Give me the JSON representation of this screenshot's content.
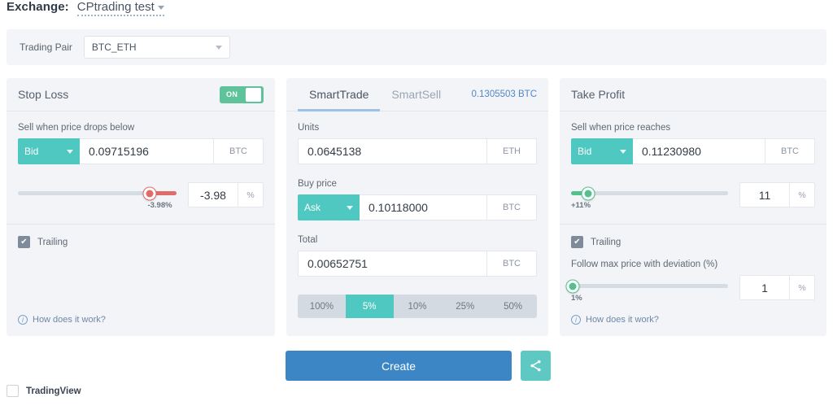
{
  "header": {
    "exchange_label": "Exchange:",
    "exchange_value": "CPtrading test"
  },
  "trading_pair": {
    "label": "Trading Pair",
    "value": "BTC_ETH"
  },
  "stop_loss": {
    "title": "Stop Loss",
    "toggle_state": "ON",
    "price_label": "Sell when price drops below",
    "side": "Bid",
    "price_value": "0.09715196",
    "price_unit": "BTC",
    "slider_caption": "-3.98%",
    "percent_value": "-3.98",
    "percent_symbol": "%",
    "trailing_label": "Trailing",
    "trailing_checked": true,
    "help_label": "How does it work?",
    "accent_color": "#e06b6b",
    "slider_position_pct": 83
  },
  "smart_trade": {
    "tabs": [
      {
        "label": "SmartTrade",
        "active": true
      },
      {
        "label": "SmartSell",
        "active": false
      }
    ],
    "balance": "0.1305503 BTC",
    "units_label": "Units",
    "units_value": "0.0645138",
    "units_unit": "ETH",
    "buy_price_label": "Buy price",
    "buy_side": "Ask",
    "buy_price_value": "0.10118000",
    "buy_price_unit": "BTC",
    "total_label": "Total",
    "total_value": "0.00652751",
    "total_unit": "BTC",
    "percent_buttons": [
      {
        "label": "100%",
        "active": false
      },
      {
        "label": "5%",
        "active": true
      },
      {
        "label": "10%",
        "active": false
      },
      {
        "label": "25%",
        "active": false
      },
      {
        "label": "50%",
        "active": false
      }
    ]
  },
  "take_profit": {
    "title": "Take Profit",
    "price_label": "Sell when price reaches",
    "side": "Bid",
    "price_value": "0.11230980",
    "price_unit": "BTC",
    "slider_caption": "+11%",
    "percent_value": "11",
    "percent_symbol": "%",
    "trailing_label": "Trailing",
    "trailing_checked": true,
    "deviation_label": "Follow max price with deviation (%)",
    "deviation_caption": "1%",
    "deviation_value": "1",
    "deviation_symbol": "%",
    "help_label": "How does it work?",
    "accent_color": "#53c08d",
    "slider_position_pct": 11,
    "deviation_position_pct": 1
  },
  "footer": {
    "create_label": "Create",
    "share_icon": "share-icon",
    "tradingview_label": "TradingView",
    "tradingview_checked": false
  }
}
